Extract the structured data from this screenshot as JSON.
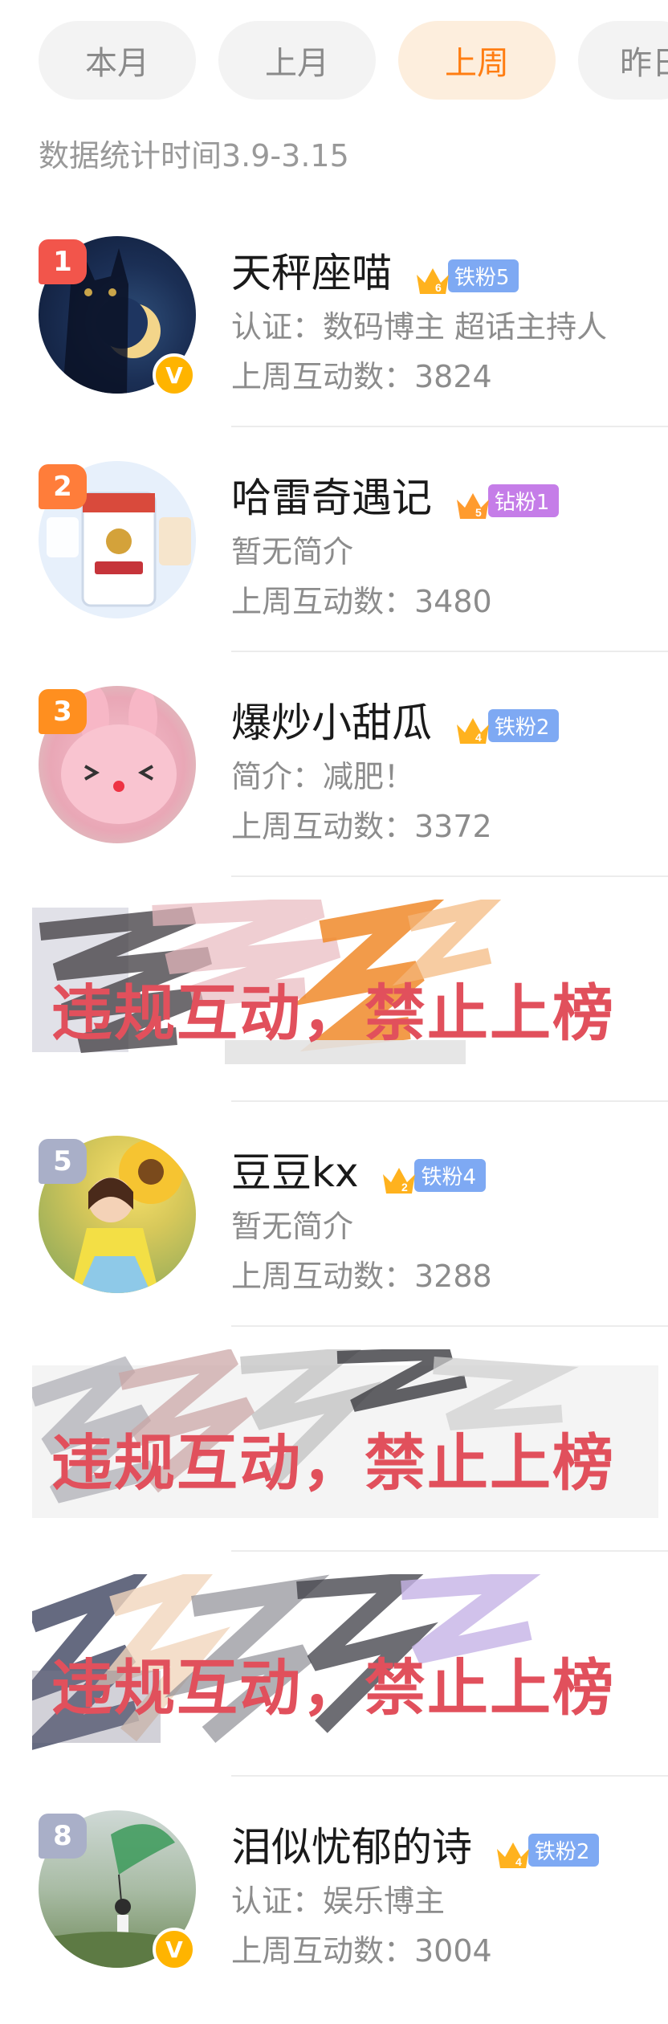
{
  "tabs": [
    {
      "label": "本月",
      "active": false
    },
    {
      "label": "上月",
      "active": false
    },
    {
      "label": "上周",
      "active": true
    },
    {
      "label": "昨日",
      "active": false
    }
  ],
  "stats_period": "数据统计时间3.9-3.15",
  "colors": {
    "accent": "#ff7d12",
    "rank_top": [
      "#f2554b",
      "#ff7d3a",
      "#ff8f1f"
    ],
    "rank_other": "#a9afc8",
    "violation": "#e1505c"
  },
  "entries": [
    {
      "rank": "1",
      "name": "天秤座喵",
      "level": "6",
      "fan_badge": "铁粉5",
      "desc": "认证：数码博主 超话主持人",
      "count": "上周互动数：3824",
      "verified": true,
      "avatar_icon": "cat-moon-avatar"
    },
    {
      "rank": "2",
      "name": "哈雷奇遇记",
      "level": "5",
      "fan_badge": "钻粉1",
      "desc": "暂无简介",
      "count": "上周互动数：3480",
      "verified": false,
      "avatar_icon": "milk-powder-avatar"
    },
    {
      "rank": "3",
      "name": "爆炒小甜瓜",
      "level": "4",
      "fan_badge": "铁粉2",
      "desc": "简介：减肥！",
      "count": "上周互动数：3372",
      "verified": false,
      "avatar_icon": "pink-bunny-avatar"
    },
    {
      "violation": "违规互动，禁止上榜"
    },
    {
      "rank": "5",
      "name": "豆豆kx",
      "level": "2",
      "fan_badge": "铁粉4",
      "desc": "暂无简介",
      "count": "上周互动数：3288",
      "verified": false,
      "avatar_icon": "sunflower-girl-avatar"
    },
    {
      "violation": "违规互动，禁止上榜"
    },
    {
      "violation": "违规互动，禁止上榜"
    },
    {
      "rank": "8",
      "name": "泪似忧郁的诗",
      "level": "4",
      "fan_badge": "铁粉2",
      "desc": "认证：娱乐博主",
      "count": "上周互动数：3004",
      "verified": true,
      "avatar_icon": "kite-field-avatar"
    }
  ]
}
